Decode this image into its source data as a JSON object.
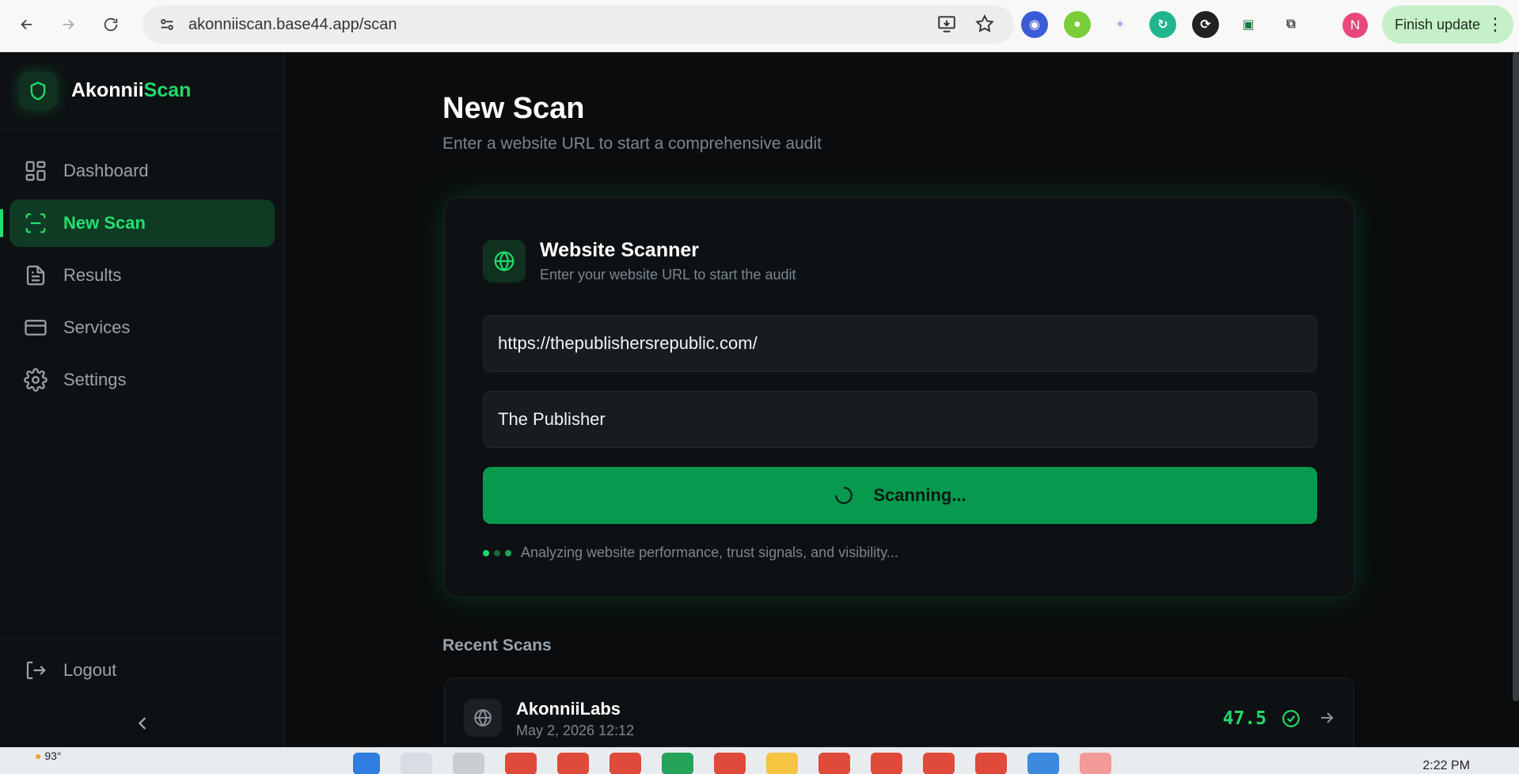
{
  "browser": {
    "url": "akonniiscan.base44.app/scan",
    "finish_update_label": "Finish update",
    "profile_initial": "N"
  },
  "sidebar": {
    "brand_part1": "Akonnii",
    "brand_part2": "Scan",
    "items": [
      {
        "label": "Dashboard",
        "icon": "dashboard-icon"
      },
      {
        "label": "New Scan",
        "icon": "scan-icon",
        "active": true
      },
      {
        "label": "Results",
        "icon": "file-icon"
      },
      {
        "label": "Services",
        "icon": "card-icon"
      },
      {
        "label": "Settings",
        "icon": "gear-icon"
      }
    ],
    "logout_label": "Logout"
  },
  "main": {
    "title": "New Scan",
    "subtitle": "Enter a website URL to start a comprehensive audit",
    "scanner": {
      "title": "Website Scanner",
      "description": "Enter your website URL to start the audit",
      "url_value": "https://thepublishersrepublic.com/",
      "name_value": "The Publisher",
      "button_label": "Scanning...",
      "status_text": "Analyzing website performance, trust signals, and visibility..."
    },
    "recent": {
      "title": "Recent Scans",
      "items": [
        {
          "name": "AkonniiLabs",
          "date": "May 2, 2026 12:12",
          "score": "47.5"
        }
      ]
    }
  },
  "taskbar": {
    "temperature": "93°",
    "time": "2:22 PM"
  },
  "colors": {
    "accent": "#22d96b",
    "button": "#079a4f",
    "background": "#0a0c0d"
  }
}
